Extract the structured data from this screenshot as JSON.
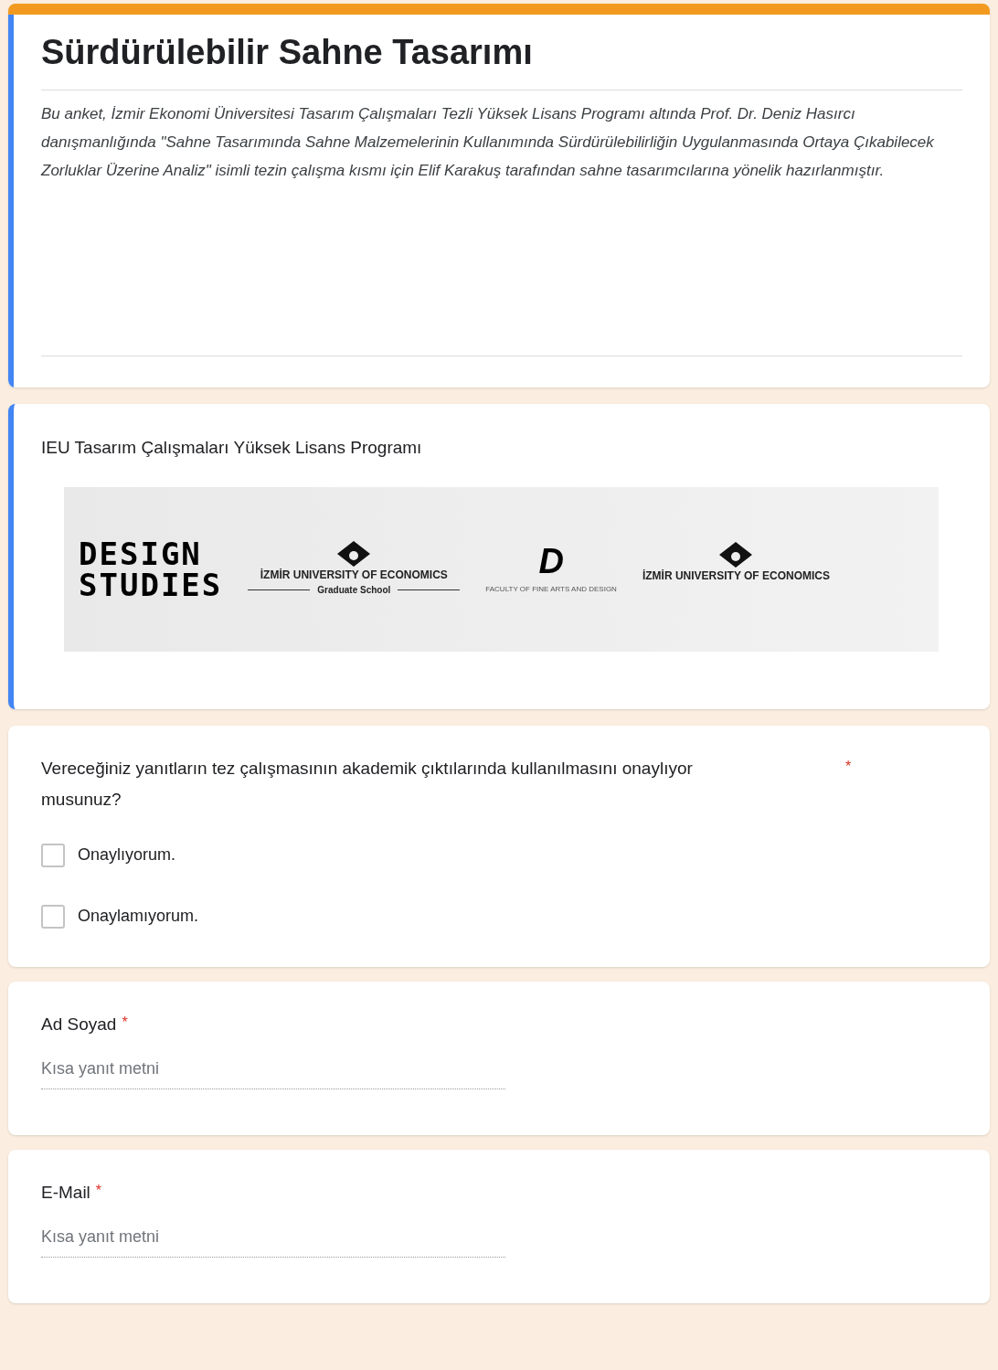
{
  "header": {
    "title": "Sürdürülebilir Sahne Tasarımı",
    "description": "Bu anket, İzmir Ekonomi Üniversitesi Tasarım Çalışmaları Tezli Yüksek Lisans Programı altında Prof. Dr. Deniz Hasırcı danışmanlığında \"Sahne Tasarımında Sahne Malzemelerinin Kullanımında Sürdürülebilirliğin Uygulanmasında Ortaya Çıkabilecek Zorluklar Üzerine Analiz\" isimli tezin çalışma kısmı için Elif Karakuş tarafından sahne tasarımcılarına yönelik hazırlanmıştır."
  },
  "image_section": {
    "title": "IEU Tasarım Çalışmaları Yüksek Lisans Programı",
    "banner": {
      "design_studies": [
        "DESIGN",
        "STUDIES"
      ],
      "graduate_logo": {
        "name": "İZMİR UNIVERSITY OF ECONOMICS",
        "subtitle": "Graduate School"
      },
      "faculty_logo": {
        "letter": "D",
        "name": "FACULTY OF FINE ARTS AND DESIGN"
      },
      "university_logo": {
        "name": "İZMİR UNIVERSITY OF ECONOMICS"
      }
    }
  },
  "questions": [
    {
      "kind": "checkbox",
      "title": "Vereceğiniz yanıtların tez çalışmasının akademik çıktılarında kullanılmasını onaylıyor musunuz?",
      "required": true,
      "required_mark": "*",
      "options": [
        {
          "label": "Onaylıyorum.",
          "checked": false
        },
        {
          "label": "Onaylamıyorum.",
          "checked": false
        }
      ]
    },
    {
      "kind": "text",
      "title": "Ad Soyad",
      "required": true,
      "required_mark": "*",
      "placeholder": "Kısa yanıt metni"
    },
    {
      "kind": "text",
      "title": "E-Mail",
      "required": true,
      "required_mark": "*",
      "placeholder": "Kısa yanıt metni"
    }
  ]
}
